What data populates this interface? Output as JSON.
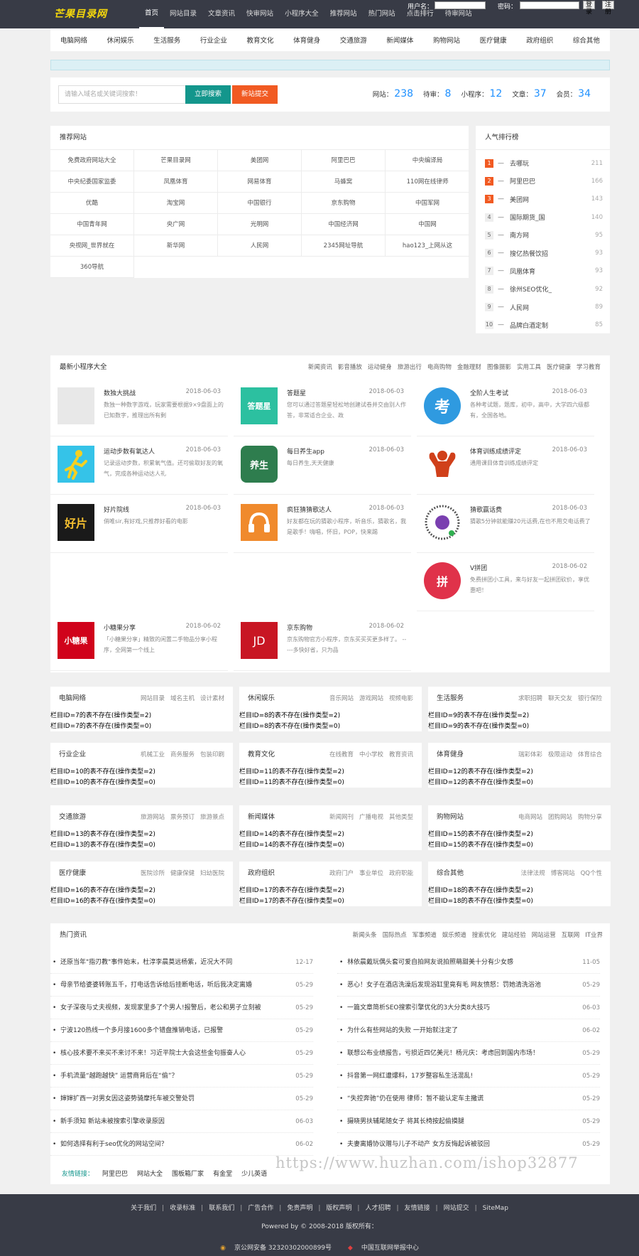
{
  "header": {
    "logo": "芒果目录网",
    "nav": [
      "首页",
      "网站目录",
      "文章资讯",
      "快审网站",
      "小程序大全",
      "推荐网站",
      "热门网站",
      "点击排行",
      "待审网站"
    ],
    "login": {
      "user_label": "用户名：",
      "pass_label": "密码：",
      "login_btn": "登录",
      "register_btn": "注册"
    }
  },
  "categories": [
    "电脑网络",
    "休闲娱乐",
    "生活服务",
    "行业企业",
    "教育文化",
    "体育健身",
    "交通旅游",
    "新闻媒体",
    "购物网站",
    "医疗健康",
    "政府组织",
    "综合其他"
  ],
  "search": {
    "placeholder": "请输入域名或关键词搜索！",
    "search_btn": "立即搜索",
    "submit_btn": "新站提交"
  },
  "stats": [
    {
      "label": "网站：",
      "value": "238"
    },
    {
      "label": "待审：",
      "value": "8"
    },
    {
      "label": "小程序：",
      "value": "12"
    },
    {
      "label": "文章：",
      "value": "37"
    },
    {
      "label": "会员：",
      "value": "34"
    }
  ],
  "recommended": {
    "title": "推荐网站",
    "sites": [
      "免费政府网站大全",
      "芒果目录网",
      "美团网",
      "阿里巴巴",
      "中央编译局",
      "中央纪委国家监委",
      "凤凰体育",
      "网易体育",
      "马蜂窝",
      "110网在线律师",
      "优酷",
      "淘宝网",
      "中国银行",
      "京东购物",
      "中国军网",
      "中国青年网",
      "央广网",
      "光明网",
      "中国经济网",
      "中国网",
      "央视网_世界就在",
      "新华网",
      "人民网",
      "2345网址导航",
      "hao123_上网从这",
      "360导航"
    ]
  },
  "popular": {
    "title": "人气排行榜",
    "items": [
      {
        "rank": "1",
        "name": "去哪玩",
        "count": "211"
      },
      {
        "rank": "2",
        "name": "阿里巴巴",
        "count": "166"
      },
      {
        "rank": "3",
        "name": "美团网",
        "count": "143"
      },
      {
        "rank": "4",
        "name": "国际期货_国",
        "count": "140"
      },
      {
        "rank": "5",
        "name": "南方网",
        "count": "95"
      },
      {
        "rank": "6",
        "name": "搜亿热餐饮招",
        "count": "93"
      },
      {
        "rank": "7",
        "name": "凤凰体育",
        "count": "93"
      },
      {
        "rank": "8",
        "name": "徐州SEO优化_",
        "count": "92"
      },
      {
        "rank": "9",
        "name": "人民网",
        "count": "89"
      },
      {
        "rank": "10",
        "name": "品牌白酒定制",
        "count": "85"
      }
    ]
  },
  "mini": {
    "title": "最新小程序大全",
    "tags": [
      "新闻资讯",
      "影音播放",
      "运动健身",
      "旅游出行",
      "电商购物",
      "金融理财",
      "图像摄影",
      "实用工具",
      "医疗健康",
      "学习教育"
    ],
    "cards": [
      {
        "title": "数独大挑战",
        "date": "2018-06-03",
        "desc": "数独一种数字游戏，玩家需要根据9×9盘面上的已知数字，推理出所有剩",
        "icon": "sudoku-icon",
        "bg": "#e8e8e8"
      },
      {
        "title": "答题星",
        "date": "2018-06-03",
        "desc": "您可以通过答题星轻松地创建试卷并交由别人作答，非常适合企业、政",
        "icon": "datixing-icon",
        "bg": "#2cc0a0"
      },
      {
        "title": "全阶人生考试",
        "date": "2018-06-03",
        "desc": "各种考试题，题库，初中，高中，大学四六级都有，全国各地。",
        "icon": "exam-icon",
        "bg": "#2f9ae0"
      },
      {
        "title": "运动步数有氧达人",
        "date": "2018-06-03",
        "desc": "记录运动步数，积累氧气值。还可偷取好友的氧气，完成各种运动达人礼",
        "icon": "runner-icon",
        "bg": "#35c3e8"
      },
      {
        "title": "每日养生app",
        "date": "2018-06-03",
        "desc": "每日养生,天天健康",
        "icon": "health-icon",
        "bg": "#2e7d4e"
      },
      {
        "title": "体育训练成绩评定",
        "date": "2018-06-03",
        "desc": "通用课目体育训练成绩评定",
        "icon": "muscle-icon",
        "bg": "#ffffff"
      },
      {
        "title": "好片院线",
        "date": "2018-06-03",
        "desc": "俏唯sir,有好戏,只推荐好看的电影",
        "icon": "film-icon",
        "bg": "#1a1a1a"
      },
      {
        "title": "疯狂猜猜歌达人",
        "date": "2018-06-03",
        "desc": "好友都在玩的猜歌小程序，听音乐，猜歌名，我是歌手！嗨唱，怀旧，POP，快来踢",
        "icon": "music-icon",
        "bg": "#f08a2c"
      },
      {
        "title": "猜歌赢话费",
        "date": "2018-06-03",
        "desc": "猜歌5分钟就能赚20元话费,在也不用交电话费了",
        "icon": "qrcode-icon",
        "bg": "#ffffff"
      },
      {
        "title": "V拼团",
        "date": "2018-06-02",
        "desc": "免费拼团小工具，来与好友一起拼团砍价，享优惠吧！",
        "icon": "pintuan-icon",
        "bg": "#ffffff"
      },
      {
        "title": "小糖果分享",
        "date": "2018-06-02",
        "desc": "「小糖果分享」精致的闲置二手物品分享小程序，全网第一个线上",
        "icon": "candy-icon",
        "bg": "#d0021b"
      },
      {
        "title": "京东购物",
        "date": "2018-06-02",
        "desc": "京东购物官方小程序，京东买买买更多样了。 -----多快好省，只为品",
        "icon": "jd-icon",
        "bg": "#c81623"
      }
    ],
    "icon_text": {
      "datixing": "答题星",
      "exam": "考",
      "health": "养生",
      "film": "好片",
      "pintuan": "拼",
      "candy": "小糖果",
      "jd": "JD"
    }
  },
  "catboxes": [
    {
      "title": "电脑网络",
      "subs": [
        "网站目录",
        "域名主机",
        "设计素材"
      ],
      "err": [
        "栏目ID=7的表不存在(操作类型=2)",
        "栏目ID=7的表不存在(操作类型=0)"
      ]
    },
    {
      "title": "休闲娱乐",
      "subs": [
        "音乐网站",
        "游戏网站",
        "视频电影"
      ],
      "err": [
        "栏目ID=8的表不存在(操作类型=2)",
        "栏目ID=8的表不存在(操作类型=0)"
      ]
    },
    {
      "title": "生活服务",
      "subs": [
        "求职招聘",
        "聊天交友",
        "银行保险"
      ],
      "err": [
        "栏目ID=9的表不存在(操作类型=2)",
        "栏目ID=9的表不存在(操作类型=0)"
      ]
    },
    {
      "title": "行业企业",
      "subs": [
        "机械工业",
        "商务服务",
        "包装印刷"
      ],
      "err": [
        "栏目ID=10的表不存在(操作类型=2)",
        "栏目ID=10的表不存在(操作类型=0)"
      ]
    },
    {
      "title": "教育文化",
      "subs": [
        "在线教育",
        "中小学校",
        "教育资讯"
      ],
      "err": [
        "栏目ID=11的表不存在(操作类型=2)",
        "栏目ID=11的表不存在(操作类型=0)"
      ]
    },
    {
      "title": "体育健身",
      "subs": [
        "瑞彩体彩",
        "极限运动",
        "体育综合"
      ],
      "err": [
        "栏目ID=12的表不存在(操作类型=2)",
        "栏目ID=12的表不存在(操作类型=0)"
      ]
    },
    {
      "title": "交通旅游",
      "subs": [
        "旅游网站",
        "票务预订",
        "旅游景点"
      ],
      "err": [
        "栏目ID=13的表不存在(操作类型=2)",
        "栏目ID=13的表不存在(操作类型=0)"
      ]
    },
    {
      "title": "新闻媒体",
      "subs": [
        "新闻网刊",
        "广播电视",
        "其他类型"
      ],
      "err": [
        "栏目ID=14的表不存在(操作类型=2)",
        "栏目ID=14的表不存在(操作类型=0)"
      ]
    },
    {
      "title": "购物网站",
      "subs": [
        "电商网站",
        "团购网站",
        "购物分享"
      ],
      "err": [
        "栏目ID=15的表不存在(操作类型=2)",
        "栏目ID=15的表不存在(操作类型=0)"
      ]
    },
    {
      "title": "医疗健康",
      "subs": [
        "医院诊所",
        "健康保健",
        "妇幼医院"
      ],
      "err": [
        "栏目ID=16的表不存在(操作类型=2)",
        "栏目ID=16的表不存在(操作类型=0)"
      ]
    },
    {
      "title": "政府组织",
      "subs": [
        "政府门户",
        "事业单位",
        "政府职能"
      ],
      "err": [
        "栏目ID=17的表不存在(操作类型=2)",
        "栏目ID=17的表不存在(操作类型=0)"
      ]
    },
    {
      "title": "综合其他",
      "subs": [
        "法律法规",
        "博客网站",
        "QQ个性"
      ],
      "err": [
        "栏目ID=18的表不存在(操作类型=2)",
        "栏目ID=18的表不存在(操作类型=0)"
      ]
    }
  ],
  "news": {
    "title": "热门资讯",
    "tags": [
      "新闻头条",
      "国际热点",
      "军事频道",
      "娱乐频道",
      "搜索优化",
      "建站经验",
      "网站运营",
      "互联网",
      "IT业界"
    ],
    "left": [
      {
        "t": "还原当年\"指刃教\"事件始末，杜淳李晨莫远杨紫，近况大不同",
        "d": "12-17"
      },
      {
        "t": "母亲节给婆婆转账五千，打电话告诉给后挂断电话，听后我决定离婚",
        "d": "05-29"
      },
      {
        "t": "女子深夜与丈夫视频，发现家里多了个男人!报警后，老公和男子立刻被",
        "d": "05-29"
      },
      {
        "t": "宁波120热线一个多月接1600多个错盘推销电话，已报警",
        "d": "05-29"
      },
      {
        "t": "核心技术要不来买不来讨不来！习近平院士大会这些金句振奋人心",
        "d": "05-29"
      },
      {
        "t": "手机流量“越跑越快” 运营商背后在“偷”？",
        "d": "05-29"
      },
      {
        "t": "婶婶扩西一对男女因这姿势骑摩托车被交警处罚",
        "d": "05-29"
      },
      {
        "t": "新手须知 新站未被搜索引擎收录原因",
        "d": "06-03"
      },
      {
        "t": "如何选择有利于seo优化的网站空间？",
        "d": "06-02"
      }
    ],
    "right": [
      {
        "t": "林依晨戴玩偶头套可爱自拍网友说拍照萌甜美十分有少女感",
        "d": "11-05"
      },
      {
        "t": "恶心！女子在酒店洗澡后发现浴缸里竟有毛 网友愤怒：罚她清洗浴池",
        "d": "05-29"
      },
      {
        "t": "一篇文章简析SEO搜索引擎优化的3大分类8大技巧",
        "d": "06-03"
      },
      {
        "t": "为什么有些网站的失败 一开始就注定了",
        "d": "06-02"
      },
      {
        "t": "联想公布业绩报告，亏损近四亿美元！杨元庆：考虑回到国内市场！",
        "d": "05-29"
      },
      {
        "t": "抖音第一网红遭爆料，17岁整容私生活混乱!",
        "d": "05-29"
      },
      {
        "t": "“失控奔驰”仍在使用 律师：暂不能认定车主撒谎",
        "d": "05-29"
      },
      {
        "t": "摄晓男扶辅尾随女子 将其长椅按起偷摸腿",
        "d": "05-29"
      },
      {
        "t": "夫妻离婚协议赠与儿子不动产 女方反悔起诉被驳回",
        "d": "05-29"
      }
    ]
  },
  "links": {
    "label": "友情链接：",
    "items": [
      "阿里巴巴",
      "网站大全",
      "围板箱厂家",
      "有金堂",
      "少儿英语"
    ]
  },
  "watermark": "https://www.huzhan.com/ishop32877",
  "footer": {
    "nav": [
      "关于我们",
      "收录标准",
      "联系我们",
      "广告合作",
      "免责声明",
      "版权声明",
      "人才招聘",
      "友情链接",
      "网站提交",
      "SiteMap"
    ],
    "copyright": "Powered by © 2008-2018 版权所有：",
    "beian": "京公网安备 32320302000899号",
    "report": "中国互联网举报中心"
  },
  "colors": {
    "header_bg": "#383b46",
    "accent_teal": "#13968c",
    "accent_orange": "#f15a22",
    "stat_blue": "#1e90ff",
    "logo_yellow": "#f6d80b"
  }
}
